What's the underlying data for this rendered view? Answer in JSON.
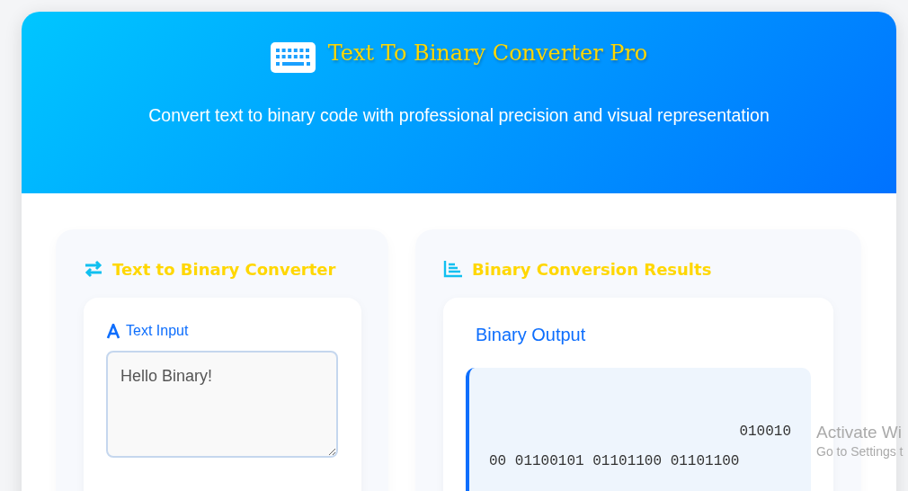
{
  "header": {
    "title": "Text To Binary Converter Pro",
    "subtitle": "Convert text to binary code with professional precision and visual representation"
  },
  "input_panel": {
    "title": "Text to Binary Converter",
    "field_label": "Text Input",
    "value": "Hello Binary!"
  },
  "results_panel": {
    "title": "Binary Conversion Results",
    "output_title": "Binary Output",
    "lines": [
      "010010",
      "00 01100101 01101100 01101100"
    ]
  },
  "os_watermark": {
    "title": "Activate Wi",
    "hint": "Go to Settings t"
  }
}
